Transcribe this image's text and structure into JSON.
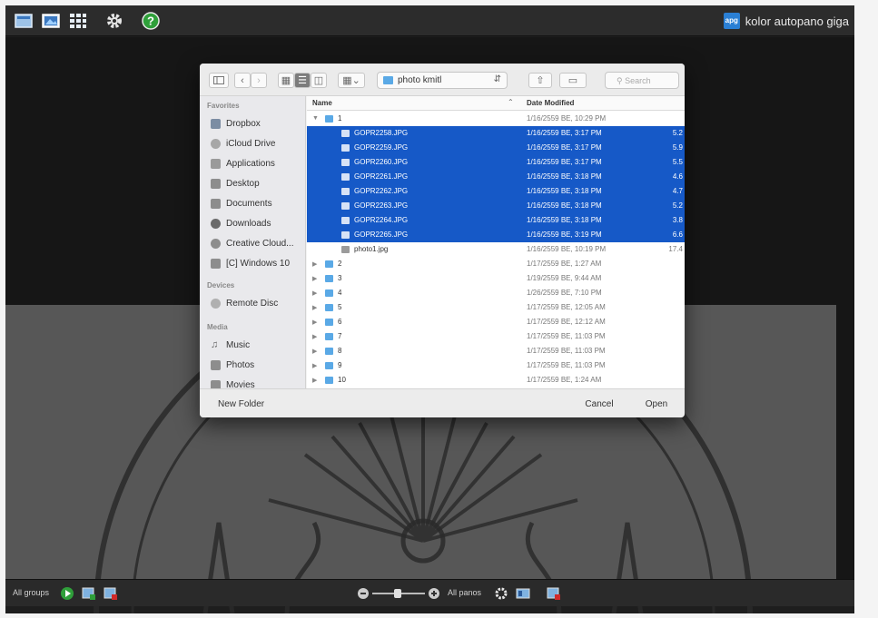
{
  "app": {
    "brand": "kolor autopano giga",
    "brand_logo": "apg",
    "toolbar_icons": [
      "new-project-icon",
      "image-icon",
      "grid-icon",
      "gear-icon",
      "help-icon"
    ],
    "accent": "#1659c7"
  },
  "dialog": {
    "path": "photo kmitl",
    "search_placeholder": "Search",
    "sidebar": {
      "favorites_label": "Favorites",
      "favorites": [
        "Dropbox",
        "iCloud Drive",
        "Applications",
        "Desktop",
        "Documents",
        "Downloads",
        "Creative Cloud...",
        "[C] Windows 10"
      ],
      "devices_label": "Devices",
      "devices": [
        "Remote Disc"
      ],
      "media_label": "Media",
      "media": [
        "Music",
        "Photos",
        "Movies"
      ]
    },
    "columns": {
      "name": "Name",
      "date": "Date Modified"
    },
    "rows": [
      {
        "name": "1",
        "kind": "folder-open",
        "date": "1/16/2559 BE, 10:29 PM",
        "size": "",
        "selected": false
      },
      {
        "name": "GOPR2258.JPG",
        "kind": "image",
        "date": "1/16/2559 BE, 3:17 PM",
        "size": "5.2",
        "selected": true
      },
      {
        "name": "GOPR2259.JPG",
        "kind": "image",
        "date": "1/16/2559 BE, 3:17 PM",
        "size": "5.9",
        "selected": true
      },
      {
        "name": "GOPR2260.JPG",
        "kind": "image",
        "date": "1/16/2559 BE, 3:17 PM",
        "size": "5.5",
        "selected": true
      },
      {
        "name": "GOPR2261.JPG",
        "kind": "image",
        "date": "1/16/2559 BE, 3:18 PM",
        "size": "4.6",
        "selected": true
      },
      {
        "name": "GOPR2262.JPG",
        "kind": "image",
        "date": "1/16/2559 BE, 3:18 PM",
        "size": "4.7",
        "selected": true
      },
      {
        "name": "GOPR2263.JPG",
        "kind": "image",
        "date": "1/16/2559 BE, 3:18 PM",
        "size": "5.2",
        "selected": true
      },
      {
        "name": "GOPR2264.JPG",
        "kind": "image",
        "date": "1/16/2559 BE, 3:18 PM",
        "size": "3.8",
        "selected": true
      },
      {
        "name": "GOPR2265.JPG",
        "kind": "image",
        "date": "1/16/2559 BE, 3:19 PM",
        "size": "6.6",
        "selected": true
      },
      {
        "name": "photo1.jpg",
        "kind": "file",
        "date": "1/16/2559 BE, 10:19 PM",
        "size": "17.4",
        "selected": false
      },
      {
        "name": "2",
        "kind": "folder",
        "date": "1/17/2559 BE, 1:27 AM",
        "size": "",
        "selected": false
      },
      {
        "name": "3",
        "kind": "folder",
        "date": "1/19/2559 BE, 9:44 AM",
        "size": "",
        "selected": false
      },
      {
        "name": "4",
        "kind": "folder",
        "date": "1/26/2559 BE, 7:10 PM",
        "size": "",
        "selected": false
      },
      {
        "name": "5",
        "kind": "folder",
        "date": "1/17/2559 BE, 12:05 AM",
        "size": "",
        "selected": false
      },
      {
        "name": "6",
        "kind": "folder",
        "date": "1/17/2559 BE, 12:12 AM",
        "size": "",
        "selected": false
      },
      {
        "name": "7",
        "kind": "folder",
        "date": "1/17/2559 BE, 11:03 PM",
        "size": "",
        "selected": false
      },
      {
        "name": "8",
        "kind": "folder",
        "date": "1/17/2559 BE, 11:03 PM",
        "size": "",
        "selected": false
      },
      {
        "name": "9",
        "kind": "folder",
        "date": "1/17/2559 BE, 11:03 PM",
        "size": "",
        "selected": false
      },
      {
        "name": "10",
        "kind": "folder",
        "date": "1/17/2559 BE, 1:24 AM",
        "size": "",
        "selected": false
      }
    ],
    "footer": {
      "new_folder": "New Folder",
      "cancel": "Cancel",
      "open": "Open"
    }
  },
  "bottombar": {
    "left_label": "All groups",
    "right_label": "All panos"
  }
}
